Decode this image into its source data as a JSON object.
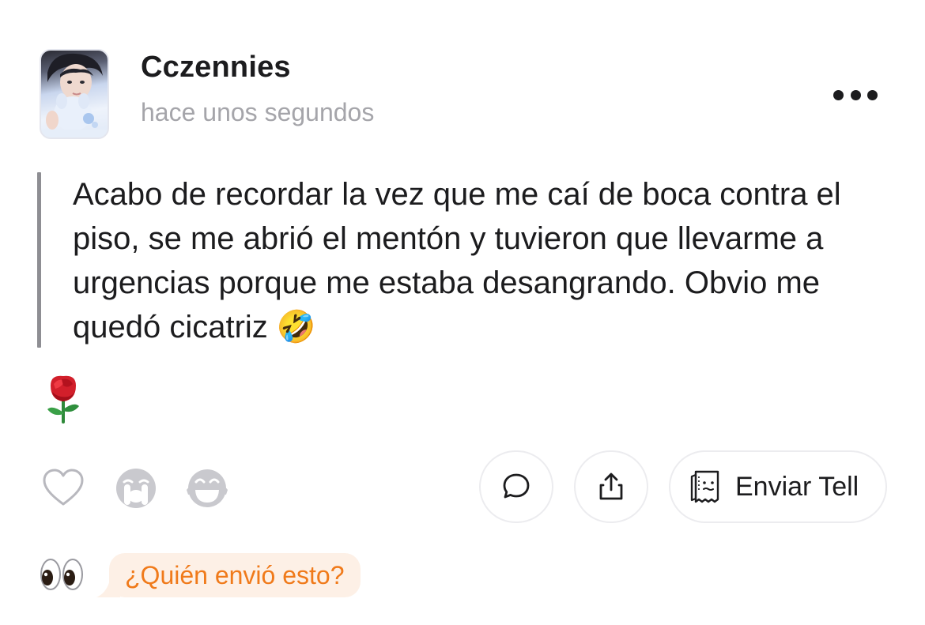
{
  "post": {
    "username": "Cczennies",
    "timestamp": "hace unos segundos",
    "text": "Acabo de recordar la vez que me caí de boca contra el piso, se me abrió el mentón y tuvieron que llevarme a urgencias porque me estaba desangrando. Obvio me quedó cicatriz 🤣"
  },
  "reactions": {
    "items": [
      "heart-icon",
      "crying-face-icon",
      "laughing-face-icon"
    ],
    "received": "rose"
  },
  "actions": {
    "comment_icon": "comment-bubble-icon",
    "share_icon": "share-icon",
    "send_label": "Enviar Tell"
  },
  "footer": {
    "prompt": "¿Quién envió esto?",
    "accent": "#f07a1a",
    "bubble_bg": "#fdf0e6"
  }
}
